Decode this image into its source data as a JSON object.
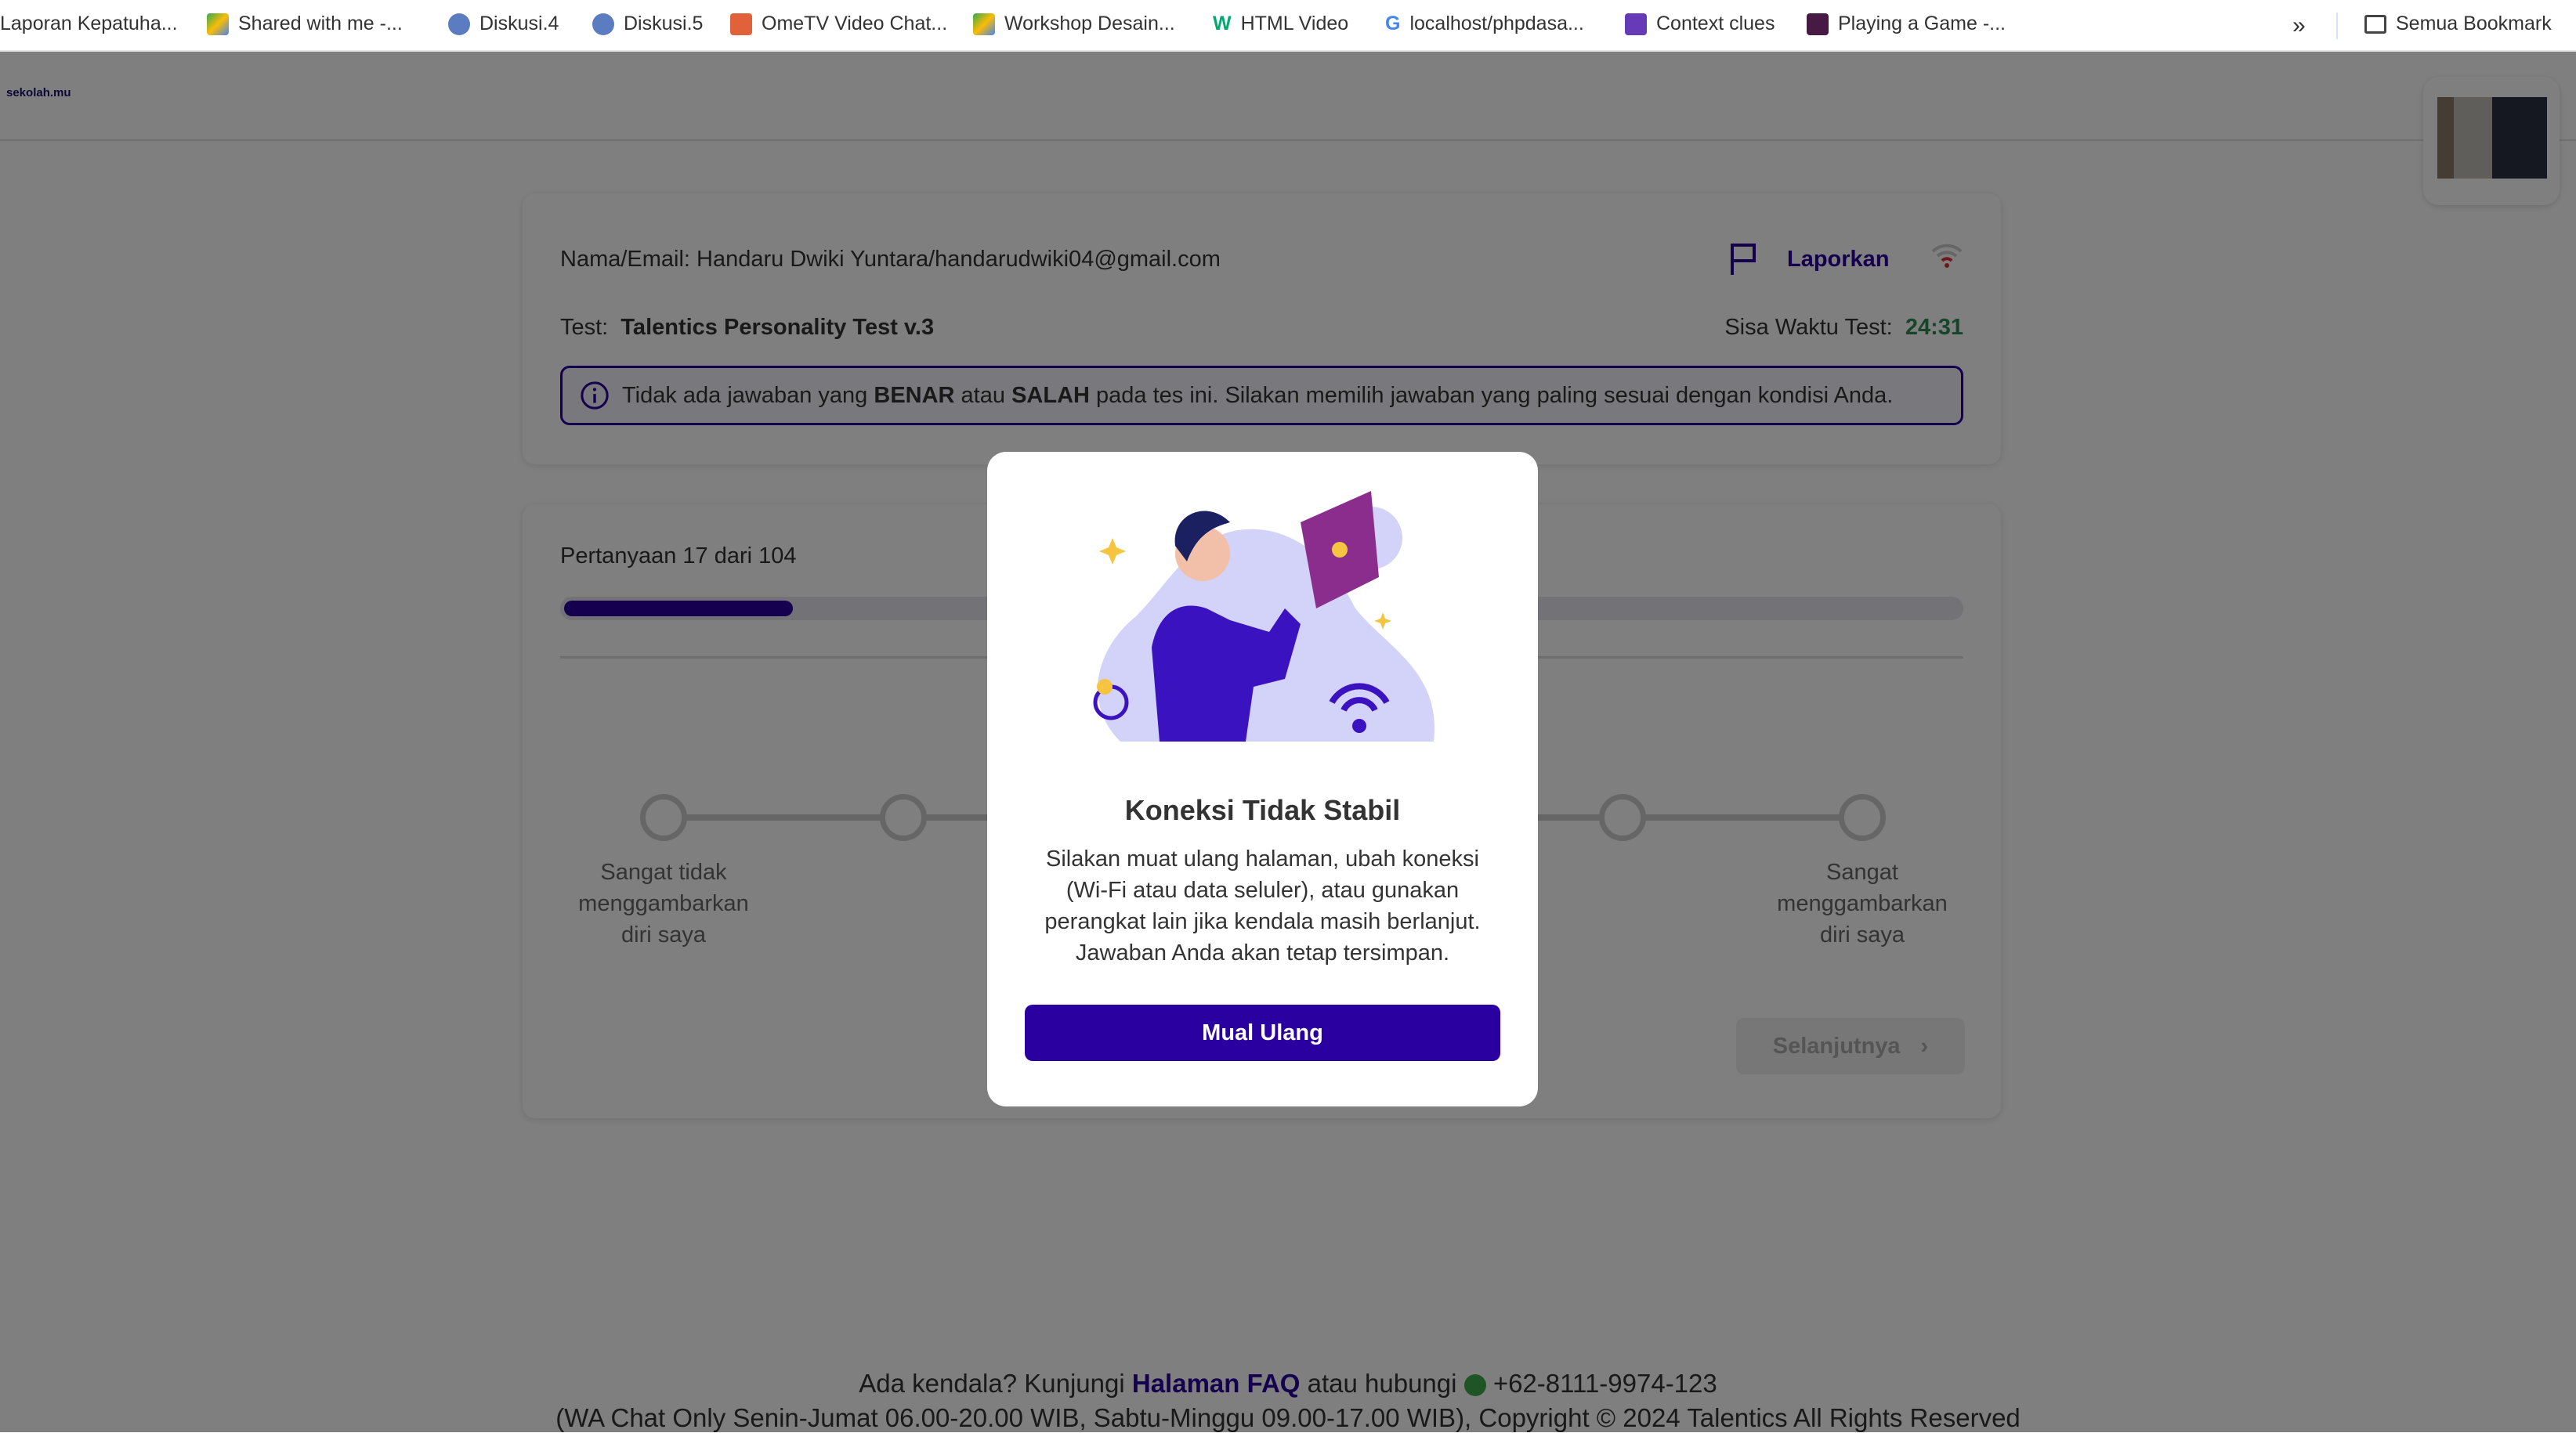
{
  "bookmarks": [
    {
      "label": "Laporan Kepatuha...",
      "icon": "none"
    },
    {
      "label": "Shared with me -...",
      "icon": "google-drive-icon"
    },
    {
      "label": "Diskusi.4",
      "icon": "moodle-icon"
    },
    {
      "label": "Diskusi.5",
      "icon": "moodle-icon"
    },
    {
      "label": "OmeTV Video Chat...",
      "icon": "ometv-icon"
    },
    {
      "label": "Workshop Desain...",
      "icon": "google-drive-icon"
    },
    {
      "label": "HTML Video",
      "icon": "w3schools-icon"
    },
    {
      "label": "localhost/phpdasa...",
      "icon": "google-icon"
    },
    {
      "label": "Context clues",
      "icon": "google-forms-icon"
    },
    {
      "label": "Playing a Game -...",
      "icon": "quizizz-icon"
    }
  ],
  "bookmarks_more": "»",
  "all_bookmarks": "Semua Bookmark",
  "logo": "sekolah.mu",
  "info": {
    "name_email": "Nama/Email: Handaru Dwiki Yuntara/handarudwiki04@gmail.com",
    "report": "Laporkan",
    "test_label": "Test:",
    "test_name": "Talentics Personality Test v.3",
    "time_label": "Sisa Waktu Test:",
    "time_value": "24:31",
    "notice": {
      "pre": "Tidak ada jawaban yang ",
      "b1": "BENAR",
      "mid": " atau ",
      "b2": "SALAH",
      "post": " pada tes ini. Silakan memilih jawaban yang paling sesuai dengan kondisi Anda."
    }
  },
  "question": {
    "counter": "Pertanyaan 17 dari 104",
    "progress": 0.163,
    "scale_min": "Sangat tidak menggambarkan diri saya",
    "scale_max": "Sangat menggambarkan diri saya",
    "next": "Selanjutnya"
  },
  "modal": {
    "title": "Koneksi Tidak Stabil",
    "body": "Silakan muat ulang halaman, ubah koneksi (Wi-Fi atau data seluler), atau gunakan perangkat lain jika kendala masih berlanjut. Jawaban Anda akan tetap tersimpan.",
    "button": "Mual Ulang"
  },
  "footer": {
    "pre": "Ada kendala? Kunjungi ",
    "faq": "Halaman FAQ",
    "mid": " atau hubungi ",
    "phone": "+62-8111-9974-123",
    "line2": "(WA Chat Only Senin-Jumat 06.00-20.00 WIB, Sabtu-Minggu 09.00-17.00 WIB), Copyright © 2024 Talentics All Rights Reserved"
  },
  "colors": {
    "primary": "#2a00a0",
    "timer": "#2f8a55"
  }
}
